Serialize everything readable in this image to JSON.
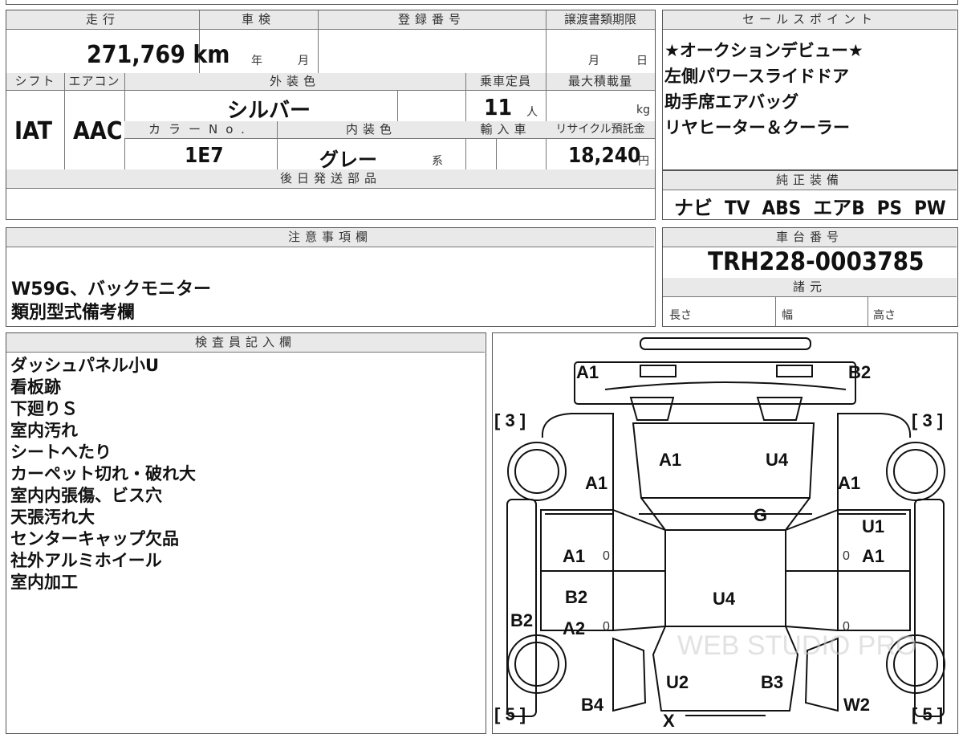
{
  "labels": {
    "mileage": "走行",
    "shaken": "車検",
    "registration_no": "登録番号",
    "transfer_deadline": "譲渡書類期限",
    "shift": "シフト",
    "aircon": "エアコン",
    "exterior_color": "外装色",
    "capacity": "乗車定員",
    "max_load": "最大積載量",
    "color_no": "カラーNo.",
    "interior_color": "内装色",
    "import": "輸入車",
    "recycle_fee": "リサイクル預託金",
    "later_parts": "後日発送部品",
    "sales_points": "セールスポイント",
    "genuine_equipment": "純正装備",
    "notes": "注意事項欄",
    "chassis_no": "車台番号",
    "specs": "諸元",
    "length": "長さ",
    "width": "幅",
    "height": "高さ",
    "inspector": "検査員記入欄",
    "year": "年",
    "month": "月",
    "day": "日",
    "persons": "人",
    "kg": "kg",
    "kei": "系",
    "yen": "円"
  },
  "vehicle": {
    "mileage": "271,769 km",
    "shift": "IAT",
    "aircon": "AAC",
    "exterior_color": "シルバー",
    "capacity": "11",
    "color_no": "1E7",
    "interior_color": "グレー",
    "recycle_fee": "18,240",
    "chassis_no": "TRH228-0003785"
  },
  "sales_points": [
    "★オークションデビュー★",
    "左側パワースライドドア",
    "助手席エアバッグ",
    "リヤヒーター＆クーラー"
  ],
  "genuine_equipment": "ナビ  TV  ABS  エアB  PS  PW",
  "notes": [
    "W59G、バックモニター",
    "類別型式備考欄"
  ],
  "inspector_notes": [
    "ダッシュパネル小U",
    "看板跡",
    "下廻りＳ",
    "室内汚れ",
    "シートへたり",
    "カーペット切れ・破れ大",
    "室内内張傷、ビス穴",
    "天張汚れ大",
    "センターキャップ欠品",
    "社外アルミホイール",
    "室内加工"
  ],
  "diagram": {
    "tire_left_top": "[ 3 ]",
    "tire_right_top": "[ 3 ]",
    "tire_left_bottom": "[ 5 ]",
    "tire_right_bottom": "[ 5 ]",
    "marks": {
      "front_left": "A1",
      "front_right": "B2",
      "windshield_l": "A1",
      "windshield_r": "U4",
      "fender_l": "A1",
      "fender_r": "A1",
      "dash": "G",
      "front_door_l": "A1",
      "front_door_r1": "U1",
      "front_door_r2": "A1",
      "roof": "U4",
      "rear_door_l1": "B2",
      "rear_door_l2": "A2",
      "side_l": "B2",
      "rear_l": "U2",
      "rear_r": "B3",
      "quarter_l": "B4",
      "quarter_r": "W2",
      "tail": "X",
      "zero": "0"
    },
    "watermark": "WEB STUDIO PRO"
  }
}
